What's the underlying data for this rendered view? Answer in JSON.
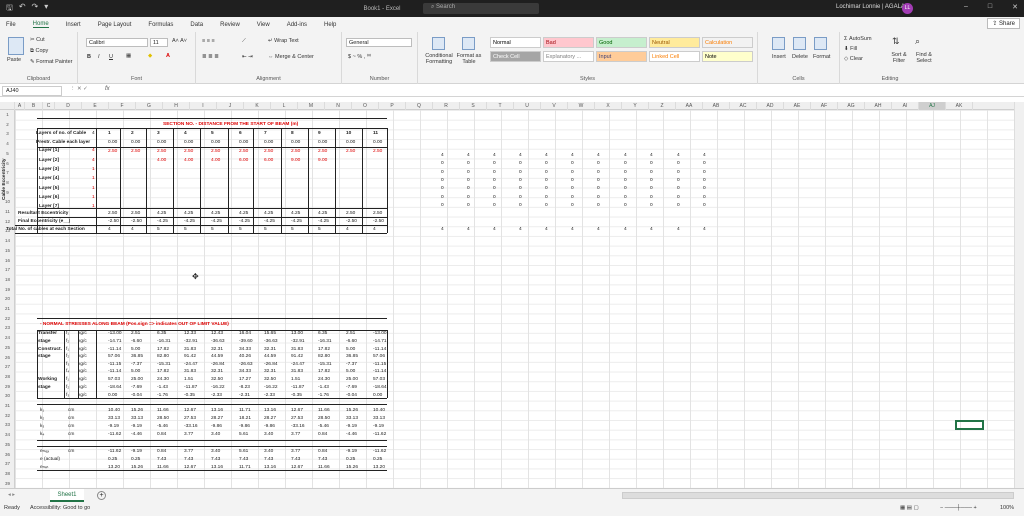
{
  "titlebar": {
    "quick_icons": [
      "save-icon",
      "undo-icon",
      "redo-icon",
      "customize-icon"
    ],
    "title": "Book1 - Excel",
    "search_placeholder": "Search",
    "user": "Lochimar Lonnie | AGALAB",
    "avatar_initials": "LL",
    "window_controls": [
      "–",
      "□",
      "✕"
    ]
  },
  "tabs": [
    "File",
    "Home",
    "Insert",
    "Page Layout",
    "Formulas",
    "Data",
    "Review",
    "View",
    "Add-ins",
    "Help"
  ],
  "share_label": "Share",
  "ribbon": {
    "clipboard": {
      "paste": "Paste",
      "cut": "Cut",
      "copy": "Copy",
      "format_painter": "Format Painter",
      "label": "Clipboard"
    },
    "font": {
      "name": "Calibri",
      "size": "11",
      "label": "Font"
    },
    "alignment": {
      "wrap": "Wrap Text",
      "merge": "Merge & Center",
      "label": "Alignment"
    },
    "number": {
      "format": "General",
      "label": "Number"
    },
    "styles": {
      "conditional": "Conditional Formatting",
      "table": "Format as Table",
      "label": "Styles",
      "cells": [
        {
          "name": "Normal",
          "bg": "#ffffff",
          "fg": "#000000"
        },
        {
          "name": "Bad",
          "bg": "#ffc7ce",
          "fg": "#9c0006"
        },
        {
          "name": "Good",
          "bg": "#c6efce",
          "fg": "#006100"
        },
        {
          "name": "Neutral",
          "bg": "#ffeb9c",
          "fg": "#9c5700"
        },
        {
          "name": "Calculation",
          "bg": "#f2f2f2",
          "fg": "#fa7d00"
        },
        {
          "name": "Check Cell",
          "bg": "#a5a5a5",
          "fg": "#ffffff"
        },
        {
          "name": "Explanatory ...",
          "bg": "#ffffff",
          "fg": "#7f7f7f"
        },
        {
          "name": "Input",
          "bg": "#ffcc99",
          "fg": "#3f3f76"
        },
        {
          "name": "Linked Cell",
          "bg": "#ffffff",
          "fg": "#fa7d00"
        },
        {
          "name": "Note",
          "bg": "#ffffcc",
          "fg": "#000000"
        }
      ]
    },
    "cells": {
      "insert": "Insert",
      "delete": "Delete",
      "format": "Format",
      "label": "Cells"
    },
    "editing": {
      "autosum": "AutoSum",
      "fill": "Fill",
      "clear": "Clear",
      "sort": "Sort & Filter",
      "find": "Find & Select",
      "label": "Editing"
    }
  },
  "formula_bar": {
    "name_box": "AJ40",
    "fx": "fx",
    "content": ""
  },
  "columns": [
    "A",
    "B",
    "C",
    "D",
    "E",
    "F",
    "G",
    "H",
    "I",
    "J",
    "K",
    "L",
    "M",
    "N",
    "O",
    "P",
    "Q",
    "R",
    "S",
    "T",
    "U",
    "V",
    "W",
    "X",
    "Y",
    "Z",
    "AA",
    "AB",
    "AC",
    "AD",
    "AE",
    "AF",
    "AG",
    "AH",
    "AI",
    "AJ",
    "AK"
  ],
  "selected_column": "AJ",
  "sheet": {
    "section_title": "SECTION NO. - DISTANCE FROM THE START OF BEAM (m)",
    "row_labels": [
      "Layers of no. of Cable",
      "Prestr. Cable each layer",
      "Layer [1]",
      "Layer [2]",
      "Layer [3]",
      "Layer [4]",
      "Layer [5]",
      "Layer [6]",
      "Layer [7]",
      "Resultant Eccentricity",
      "Final Eccentricity (e__)",
      "Total No. of cables at each Section"
    ],
    "side_label": "Cable Eccentricity",
    "col_c": [
      "4",
      "",
      "4",
      "4",
      "1",
      "1",
      "1",
      "1",
      "1",
      "",
      "",
      ""
    ],
    "col_numbers": [
      "1",
      "2",
      "3",
      "4",
      "5",
      "6",
      "7",
      "8",
      "9",
      "10",
      "11"
    ],
    "row_prestr": [
      "0.00",
      "0.00",
      "0.00",
      "0.00",
      "0.00",
      "0.00",
      "0.00",
      "0.00",
      "0.00",
      "0.00",
      "0.00"
    ],
    "row_layer1": [
      "2.50",
      "2.50",
      "2.50",
      "2.50",
      "2.50",
      "2.50",
      "2.50",
      "2.50",
      "2.50",
      "2.50",
      "2.50"
    ],
    "row_layer2": [
      "",
      "",
      "4.00",
      "4.00",
      "4.00",
      "6.00",
      "6.00",
      "9.00",
      "9.00",
      "",
      ""
    ],
    "row_result": [
      "2.50",
      "2.50",
      "4.25",
      "4.25",
      "4.25",
      "4.25",
      "4.25",
      "4.25",
      "4.25",
      "2.50",
      "2.50"
    ],
    "row_final": [
      "-2.50",
      "-2.50",
      "-4.25",
      "-4.25",
      "-4.25",
      "-4.25",
      "-4.25",
      "-4.25",
      "-4.25",
      "-2.50",
      "-2.50"
    ],
    "row_total": [
      "4",
      "4",
      "5",
      "5",
      "5",
      "5",
      "5",
      "5",
      "5",
      "4",
      "4"
    ],
    "right_grid_rows": [
      [
        "4",
        "4",
        "4",
        "4",
        "4",
        "4",
        "4",
        "4",
        "4",
        "4",
        "4"
      ],
      [
        "0",
        "0",
        "0",
        "0",
        "0",
        "0",
        "0",
        "0",
        "0",
        "0",
        "0"
      ],
      [
        "0",
        "0",
        "0",
        "0",
        "0",
        "0",
        "0",
        "0",
        "0",
        "0",
        "0"
      ],
      [
        "0",
        "0",
        "0",
        "0",
        "0",
        "0",
        "0",
        "0",
        "0",
        "0",
        "0"
      ],
      [
        "0",
        "0",
        "0",
        "0",
        "0",
        "0",
        "0",
        "0",
        "0",
        "0",
        "0"
      ],
      [
        "0",
        "0",
        "0",
        "0",
        "0",
        "0",
        "0",
        "0",
        "0",
        "0",
        "0"
      ],
      [
        "0",
        "0",
        "0",
        "0",
        "0",
        "0",
        "0",
        "0",
        "0",
        "0",
        "0"
      ]
    ],
    "right_total": [
      "4",
      "4",
      "4",
      "4",
      "4",
      "4",
      "4",
      "4",
      "4",
      "4",
      "4"
    ],
    "stress_title": "- NORMAL STRESSES ALONG BEAM (Pos.sign => indicates OUT OF LIMIT VALUE)",
    "stress_stage": [
      "Transfer",
      "stage",
      "Construct.",
      "stage",
      "",
      "",
      "Working",
      "stage",
      ""
    ],
    "stress_sym": [
      "f₁",
      "f₂",
      "f₁",
      "f₂",
      "f₃",
      "f₄",
      "f₁",
      "f₂",
      "f₃"
    ],
    "stress_unit": [
      "kg/c",
      "kg/c",
      "kg/c",
      "kg/c",
      "kg/c",
      "kg/c",
      "kg/c",
      "kg/c",
      "kg/c"
    ],
    "stress_rows": [
      [
        "-13.00",
        "2.51",
        "6.35",
        "12.33",
        "12.43",
        "16.04",
        "15.65",
        "13.00",
        "6.35",
        "2.51",
        "-13.00"
      ],
      [
        "-14.71",
        "-6.60",
        "-16.31",
        "-32.91",
        "-36.63",
        "-39.60",
        "-36.63",
        "-32.91",
        "-16.31",
        "-6.60",
        "-14.71"
      ],
      [
        "-11.14",
        "5.00",
        "17.82",
        "31.83",
        "32.31",
        "34.33",
        "32.31",
        "31.83",
        "17.82",
        "5.00",
        "-11.14"
      ],
      [
        "57.06",
        "36.85",
        "82.80",
        "91.42",
        "44.59",
        "40.26",
        "44.59",
        "91.42",
        "82.80",
        "36.85",
        "57.06"
      ],
      [
        "-11.15",
        "-7.37",
        "-15.31",
        "-24.47",
        "-26.84",
        "-26.63",
        "-26.84",
        "-24.47",
        "-15.31",
        "-7.37",
        "-11.15"
      ],
      [
        "-11.14",
        "5.00",
        "17.82",
        "31.83",
        "32.31",
        "34.33",
        "32.31",
        "31.83",
        "17.82",
        "5.00",
        "-11.14"
      ],
      [
        "57.03",
        "25.00",
        "24.30",
        "1.51",
        "32.50",
        "17.27",
        "32.50",
        "1.51",
        "24.30",
        "25.00",
        "57.03"
      ],
      [
        "-18.64",
        "-7.69",
        "-1.43",
        "-11.87",
        "-16.22",
        "-8.23",
        "-16.22",
        "-11.87",
        "-1.43",
        "-7.69",
        "-18.64"
      ],
      [
        "0.00",
        "-0.04",
        "-1.76",
        "-0.35",
        "-2.33",
        "-2.31",
        "-2.33",
        "-0.35",
        "-1.76",
        "-0.04",
        "0.00"
      ]
    ],
    "k_sym": [
      "k₁",
      "k₂",
      "k₃",
      "k₄"
    ],
    "k_unit": [
      "cm",
      "cm",
      "cm",
      "cm"
    ],
    "k_rows": [
      [
        "10.40",
        "15.26",
        "11.66",
        "12.67",
        "13.16",
        "11.71",
        "13.16",
        "12.67",
        "11.66",
        "15.26",
        "10.40"
      ],
      [
        "33.13",
        "33.13",
        "28.50",
        "27.53",
        "28.27",
        "18.21",
        "28.27",
        "27.53",
        "28.50",
        "33.13",
        "33.13"
      ],
      [
        "-9.19",
        "-9.19",
        "-5.46",
        "-33.16",
        "-9.86",
        "-9.86",
        "-9.86",
        "-33.16",
        "-5.46",
        "-9.19",
        "-9.19"
      ],
      [
        "-11.62",
        "-4.46",
        "0.84",
        "3.77",
        "3.40",
        "5.61",
        "3.40",
        "3.77",
        "0.84",
        "-4.46",
        "-11.62"
      ]
    ],
    "e_sym": [
      "eₘₐₓ",
      "e (actual)",
      "eₘᵢₙ"
    ],
    "e_unit": [
      "cm",
      "",
      ""
    ],
    "e_rows": [
      [
        "-11.62",
        "-9.19",
        "0.84",
        "3.77",
        "3.40",
        "5.61",
        "3.40",
        "3.77",
        "0.84",
        "-9.19",
        "-11.62"
      ],
      [
        "0.25",
        "0.25",
        "7.43",
        "7.43",
        "7.43",
        "7.43",
        "7.43",
        "7.43",
        "7.43",
        "0.25",
        "0.25"
      ],
      [
        "13.20",
        "15.26",
        "11.66",
        "12.67",
        "13.16",
        "11.71",
        "13.16",
        "12.67",
        "11.66",
        "15.26",
        "13.20"
      ]
    ]
  },
  "sheet_tab": "Sheet1",
  "status": {
    "ready": "Ready",
    "accessibility": "Accessibility: Good to go",
    "zoom": "100%"
  }
}
